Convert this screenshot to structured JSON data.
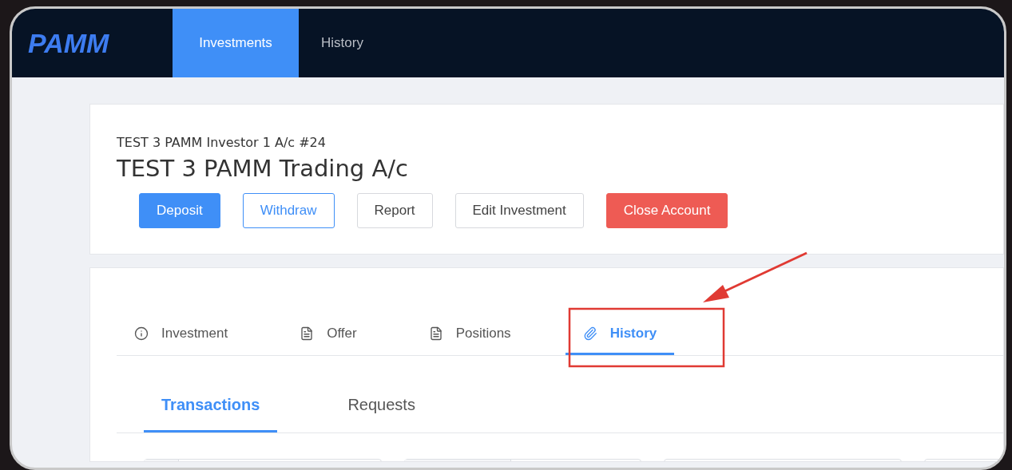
{
  "navbar": {
    "logo": "PAMM",
    "tabs": [
      {
        "label": "Investments",
        "selected": true
      },
      {
        "label": "History",
        "selected": false
      }
    ]
  },
  "account": {
    "subtitle": "TEST 3 PAMM Investor 1 A/c #24",
    "title": "TEST 3 PAMM Trading A/c",
    "buttons": [
      {
        "label": "Deposit",
        "kind": "primary"
      },
      {
        "label": "Withdraw",
        "kind": "outline"
      },
      {
        "label": "Report",
        "kind": "plain"
      },
      {
        "label": "Edit Investment",
        "kind": "plain"
      },
      {
        "label": "Close Account",
        "kind": "danger"
      }
    ]
  },
  "tabs": [
    {
      "label": "Investment",
      "kind": "info",
      "selected": false
    },
    {
      "label": "Offer",
      "kind": "document",
      "selected": false
    },
    {
      "label": "Positions",
      "kind": "document",
      "selected": false
    },
    {
      "label": "History",
      "kind": "attachment",
      "selected": true
    }
  ],
  "subtabs": [
    {
      "label": "Transactions",
      "selected": true
    },
    {
      "label": "Requests",
      "selected": false
    }
  ]
}
